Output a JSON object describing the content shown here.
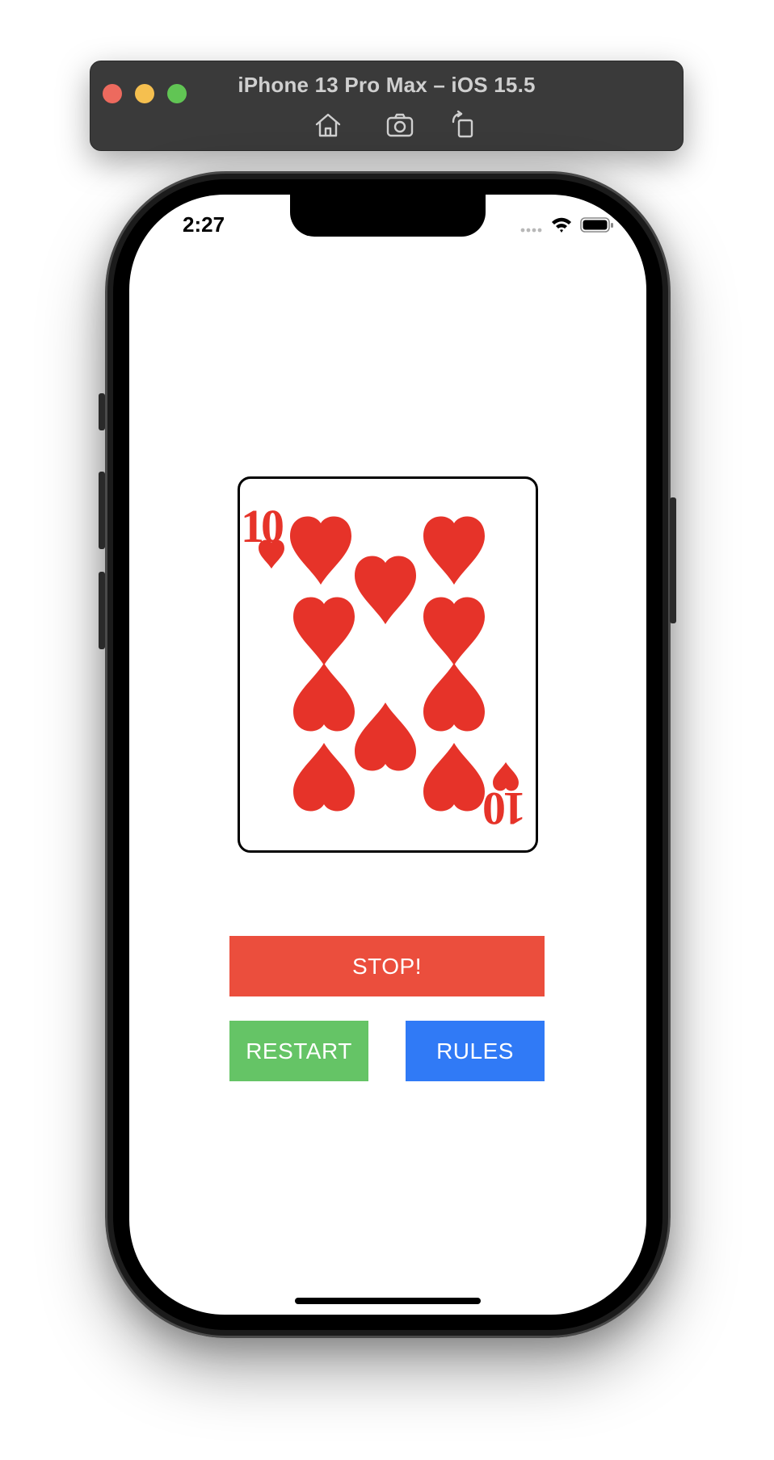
{
  "simulator": {
    "title": "iPhone 13 Pro Max – iOS 15.5",
    "tools": [
      "home-icon",
      "screenshot-icon",
      "rotate-icon"
    ]
  },
  "status_bar": {
    "time": "2:27",
    "icons": [
      "signal-icon",
      "wifi-icon",
      "battery-icon"
    ]
  },
  "card": {
    "rank": "10",
    "suit": "hearts",
    "suit_color": "#e63329"
  },
  "buttons": {
    "stop": {
      "label": "STOP!",
      "color": "#eb4e3d"
    },
    "restart": {
      "label": "RESTART",
      "color": "#65c466"
    },
    "rules": {
      "label": "RULES",
      "color": "#307af6"
    }
  }
}
